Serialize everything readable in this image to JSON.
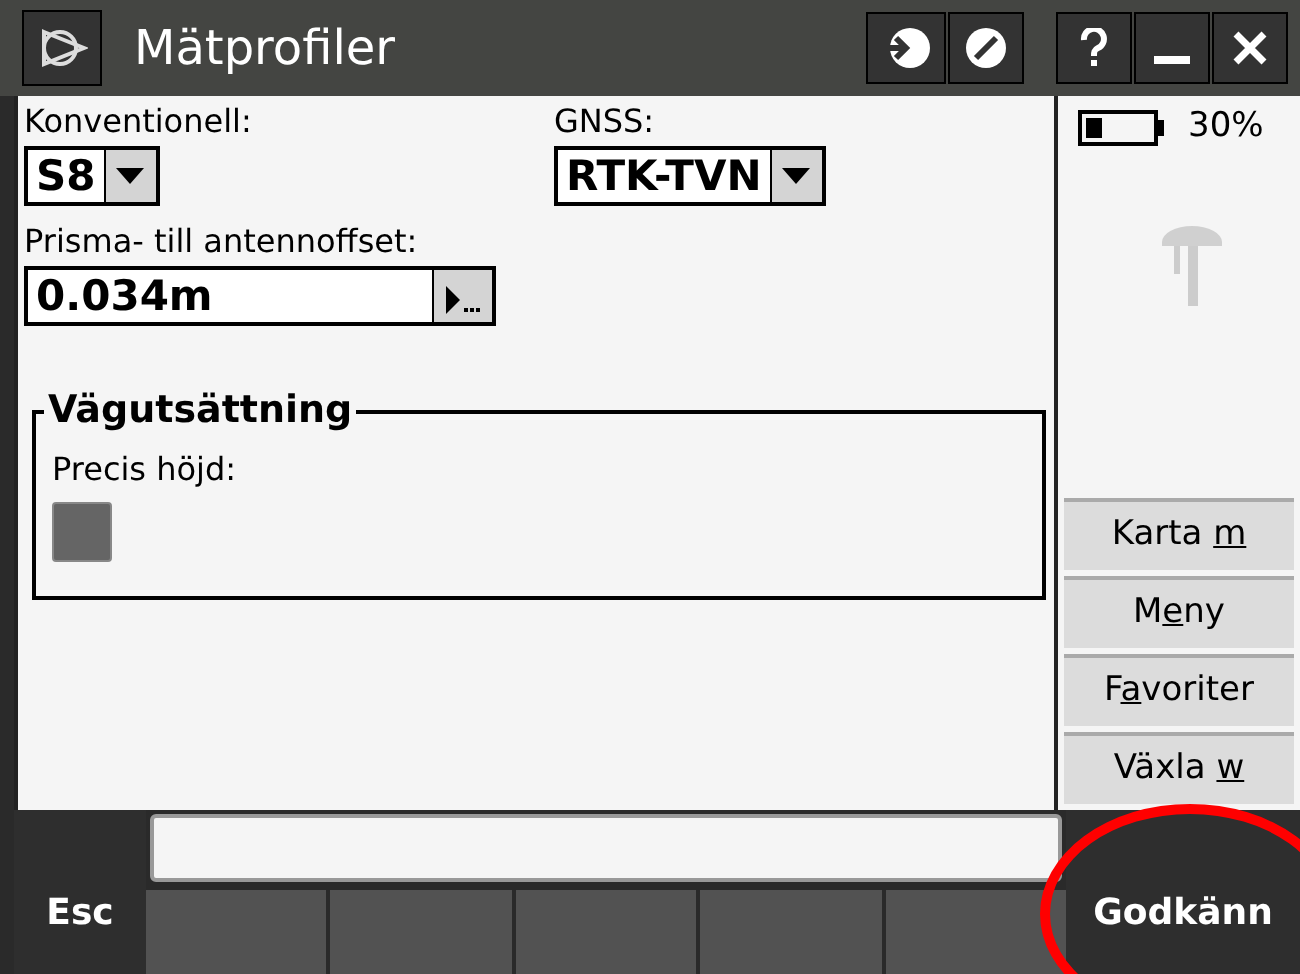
{
  "window": {
    "title": "Mätprofiler"
  },
  "fields": {
    "conventional": {
      "label": "Konventionell:",
      "value": "S8"
    },
    "gnss": {
      "label": "GNSS:",
      "value": "RTK-TVN"
    },
    "offset": {
      "label": "Prisma- till antennoffset:",
      "value": "0.034m"
    }
  },
  "group": {
    "title": "Vägutsättning",
    "precise_height": {
      "label": "Precis höjd:",
      "checked": false
    }
  },
  "status": {
    "battery": "30%"
  },
  "side_buttons": [
    {
      "before": "Karta ",
      "key": "m"
    },
    {
      "before": "M",
      "key": "e",
      "after": "ny"
    },
    {
      "before": "F",
      "key": "a",
      "after": "voriter"
    },
    {
      "before": "Växla ",
      "key": "w"
    }
  ],
  "bottom": {
    "esc": "Esc",
    "ok": "Godkänn"
  }
}
